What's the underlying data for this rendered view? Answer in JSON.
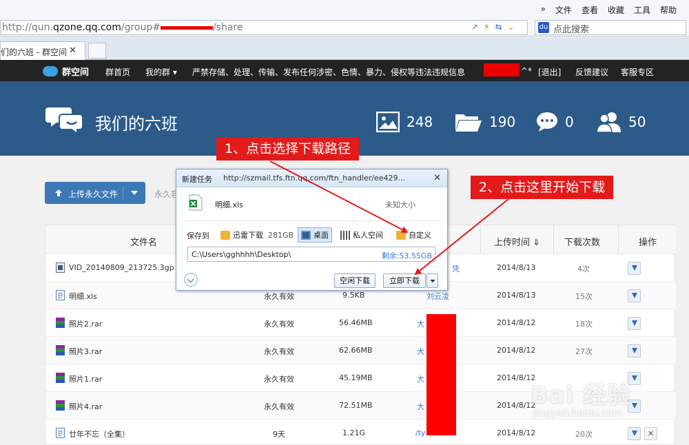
{
  "browser": {
    "menus": [
      "»",
      "文件",
      "查看",
      "收藏",
      "工具",
      "帮助"
    ],
    "url_prefix": "http://qun.",
    "url_domain": "qzone.qq.com",
    "url_path": "/group#",
    "url_suffix": "/share",
    "search_placeholder": "点此搜索",
    "tab_title": "们的六班 - 群空间",
    "tab_close": "✕"
  },
  "nav": {
    "logo": "群空间",
    "items": [
      "群首页",
      "我的群 ▾",
      "严禁存储、处理、传输、发布任何涉密、色情、暴力、侵权等违法违规信息"
    ],
    "user_suffix": "^*",
    "logout": "[退出]",
    "feedback": "反馈建议",
    "service": "客服专区"
  },
  "group": {
    "name": "我们的六班",
    "photos": "248",
    "folders": "190",
    "comments": "0",
    "members": "50"
  },
  "toolbar": {
    "upload_label": "上传永久文件",
    "perm_hint": "永久容"
  },
  "table": {
    "headers": {
      "name": "文件名",
      "time": "上传时间 ⇓",
      "downloads": "下载次数",
      "ops": "操作"
    },
    "rows": [
      {
        "name": "VID_20140809_213725.3gp",
        "validity": "",
        "size": "",
        "uploader": "凭",
        "time": "2014/8/13",
        "downloads": "4次",
        "type": "video"
      },
      {
        "name": "明细.xls",
        "validity": "永久有效",
        "size": "9.5KB",
        "uploader": "刘云凌",
        "time": "2014/8/13",
        "downloads": "15次",
        "type": "doc"
      },
      {
        "name": "照片2.rar",
        "validity": "永久有效",
        "size": "56.46MB",
        "uploader": "大",
        "time": "2014/8/12",
        "downloads": "18次",
        "type": "rar"
      },
      {
        "name": "照片3.rar",
        "validity": "永久有效",
        "size": "62.66MB",
        "uploader": "大",
        "time": "2014/8/12",
        "downloads": "27次",
        "type": "rar"
      },
      {
        "name": "照片1.rar",
        "validity": "永久有效",
        "size": "45.19MB",
        "uploader": "大",
        "time": "2014/8/12",
        "downloads": "",
        "type": "rar"
      },
      {
        "name": "照片4.rar",
        "validity": "永久有效",
        "size": "72.51MB",
        "uploader": "大",
        "time": "2014/8/12",
        "downloads": "",
        "type": "rar"
      },
      {
        "name": "廿年不忘（全集）",
        "validity": "9天",
        "size": "1.21G",
        "uploader": "/ty",
        "time": "2014/8/12",
        "downloads": "20次",
        "type": "doc"
      }
    ]
  },
  "dialog": {
    "title": "新建任务",
    "url": "http://szmail.tfs.ftn.qq.com/ftn_handler/ee429...",
    "file_name": "明细.xls",
    "file_size": "未知大小",
    "save_to": "保存到",
    "options": {
      "xunlei": "迅雷下载",
      "xunlei_size": "281GB",
      "desktop": "桌面",
      "private": "私人空间",
      "custom": "自定义"
    },
    "path": "C:\\Users\\gghhhh\\Desktop\\",
    "free_space": "剩余:53.55GB",
    "idle_button": "空闲下载",
    "download_button": "立即下载",
    "close": "✕"
  },
  "callouts": {
    "step1": "1、点击选择下载路径",
    "step2": "2、点击这里开始下载"
  },
  "watermark": {
    "brand": "Bai 经验",
    "url": "jingyan.baidu.com"
  },
  "colors": {
    "nav_bg": "#232323",
    "hero_bg": "#2c5b8a",
    "accent": "#3c78b5",
    "callout": "#e41a1a"
  }
}
